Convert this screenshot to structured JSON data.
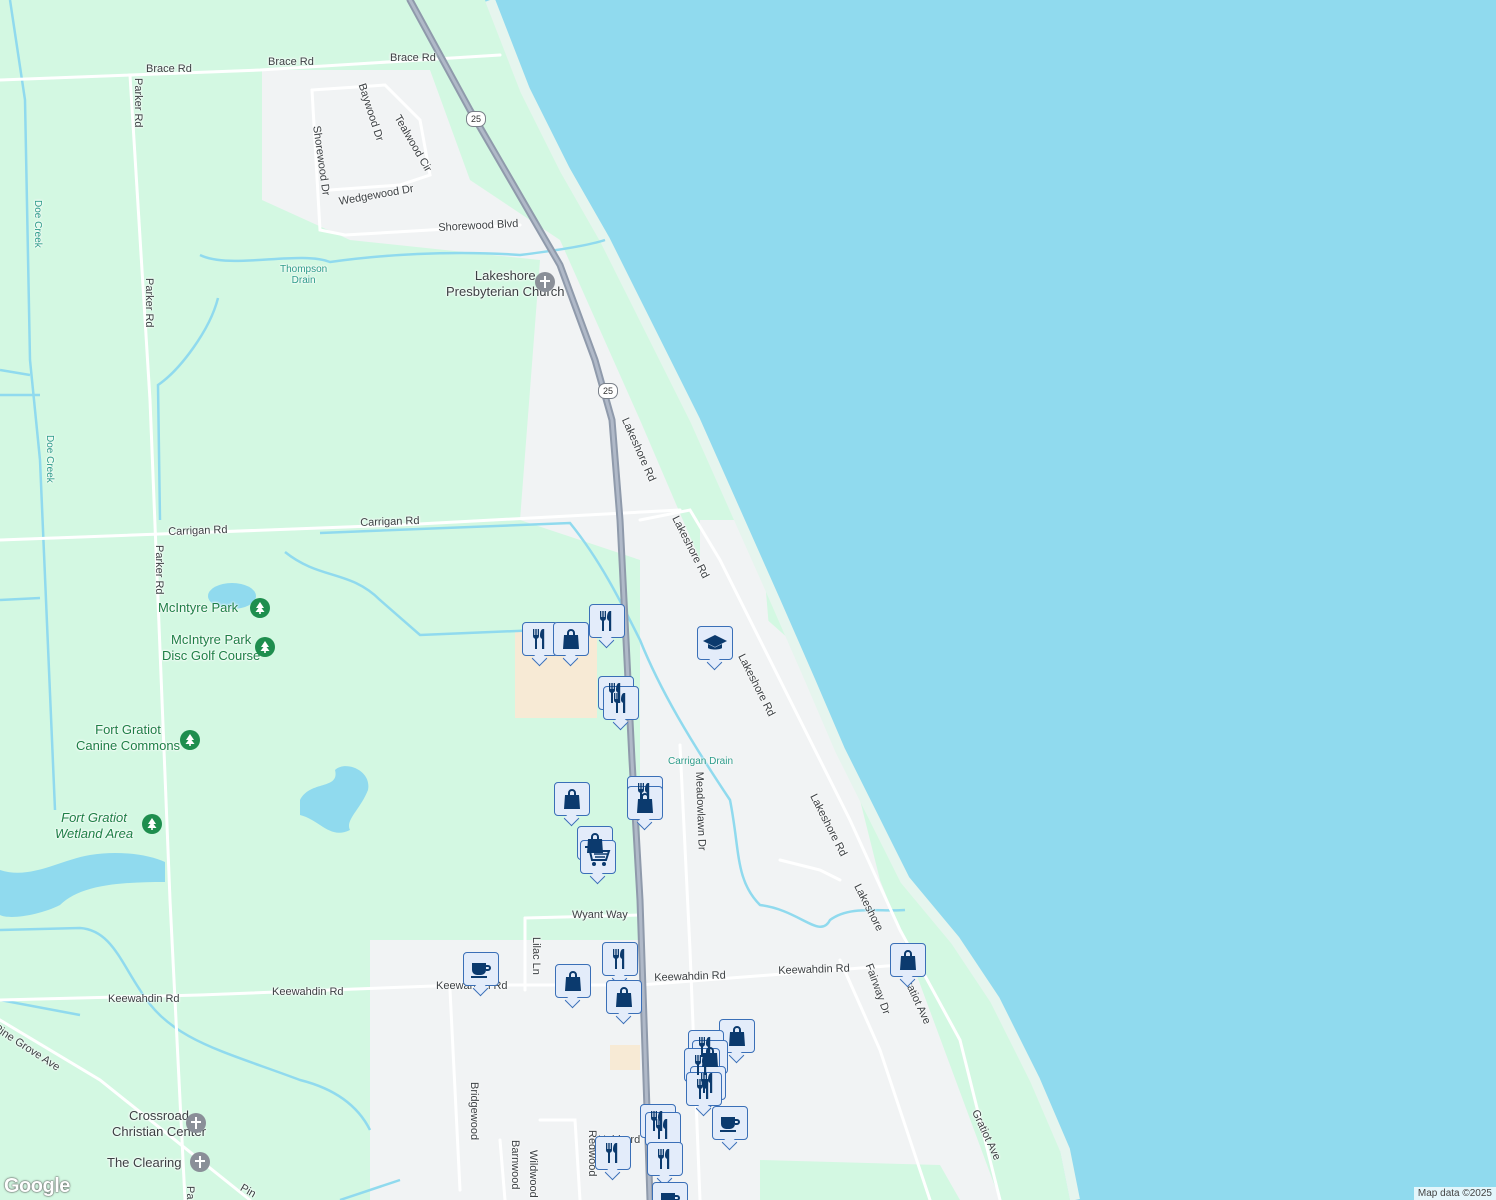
{
  "map": {
    "colors": {
      "land": "#d3f8e2",
      "water": "#90daee",
      "urban": "#f1f3f4",
      "road": "#ffffff",
      "highway": "#8f9aab",
      "commercial": "#f7ead5"
    },
    "attribution": "Map data ©2025",
    "logo": "Google",
    "roads": {
      "brace1": "Brace Rd",
      "brace2": "Brace Rd",
      "brace3": "Brace Rd",
      "parker1": "Parker Rd",
      "parker2": "Parker Rd",
      "parker3": "Parker Rd",
      "parker4": "Pa",
      "baywood": "Baywood Dr",
      "tealwood": "Tealwood Cir",
      "shorewood_dr": "Shorewood Dr",
      "wedgewood": "Wedgewood Dr",
      "shorewood_blvd": "Shorewood Blvd",
      "carrigan1": "Carrigan Rd",
      "carrigan2": "Carrigan Rd",
      "lakeshore1": "Lakeshore Rd",
      "lakeshore2": "Lakeshore Rd",
      "lakeshore3": "Lakeshore Rd",
      "lakeshore4": "Lakeshore Rd",
      "lakeshore5": "Lakeshore",
      "meadowlawn": "Meadowlawn Dr",
      "wyant": "Wyant Way",
      "lilac": "Lilac Ln",
      "keewahdin1": "Keewahdin Rd",
      "keewahdin2": "Keewahdin Rd",
      "keewahdin3": "Keewahdin Rd",
      "keewahdin4": "Keewahdin Rd",
      "fairway": "Fairway Dr",
      "gratiot1": "Gratiot Ave",
      "gratiot2": "Gratiot Ave",
      "pine_grove": "Pine Grove Ave",
      "pin": "Pin",
      "bridgewood": "Bridgewood",
      "barnwood": "Barnwood",
      "wildwood": "Wildwood",
      "redwood": "Redwood",
      "hubbard": "Hubbard"
    },
    "water_labels": {
      "doe_creek1": "Doe Creek",
      "doe_creek2": "Doe Creek",
      "thompson": [
        "Thompson",
        "Drain"
      ],
      "carrigan_drain": "Carrigan Drain"
    },
    "shields": {
      "s1": "25",
      "s2": "25"
    },
    "pois": {
      "church": [
        "Lakeshore",
        "Presbyterian Church"
      ],
      "mcintyre_park": "McIntyre Park",
      "disc_golf": [
        "McIntyre Park",
        "Disc Golf Course"
      ],
      "canine": [
        "Fort Gratiot",
        "Canine Commons"
      ],
      "wetland": [
        "Fort Gratiot",
        "Wetland Area"
      ],
      "crossroad": [
        "Crossroad",
        "Christian Center"
      ],
      "clearing": "The Clearing"
    },
    "marker_icons": [
      "restaurant-icon",
      "shopping-bag-icon",
      "cafe-icon",
      "grocery-cart-icon",
      "school-icon"
    ]
  }
}
